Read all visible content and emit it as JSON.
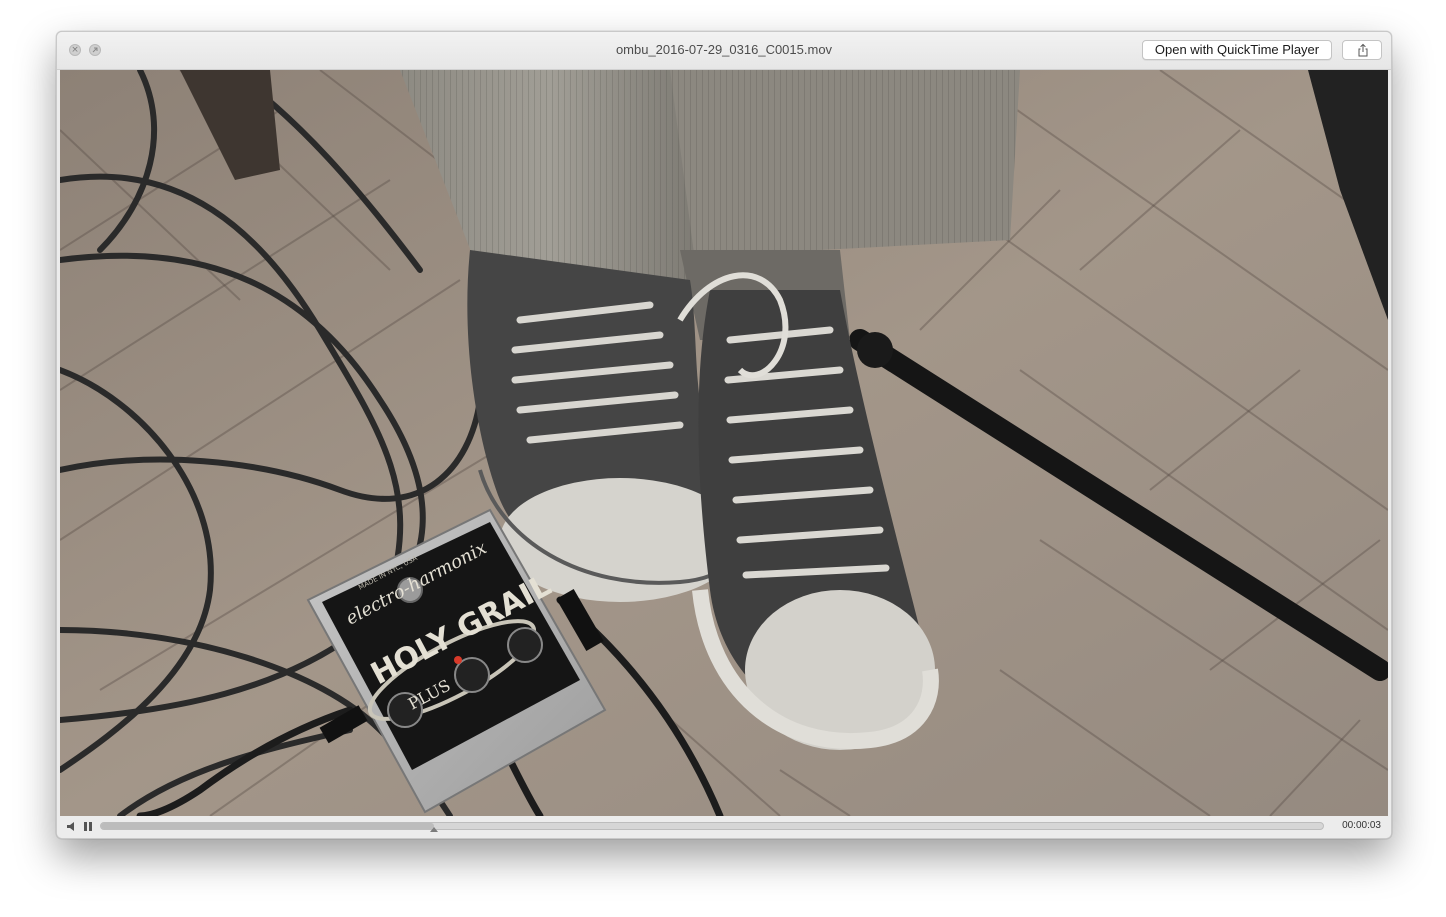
{
  "window": {
    "title": "ombu_2016-07-29_0316_C0015.mov",
    "open_button_label": "Open with QuickTime Player"
  },
  "icons": {
    "close": "close-icon",
    "fullscreen": "fullscreen-icon",
    "share": "share-icon",
    "volume": "speaker-icon",
    "pause": "pause-icon"
  },
  "player": {
    "time": "00:00:03",
    "progress": 0.272
  },
  "pedal": {
    "brand": "electro-harmonix",
    "name": "HOLY GRAIL",
    "variant": "PLUS",
    "origin": "MADE IN NYC, USA"
  }
}
